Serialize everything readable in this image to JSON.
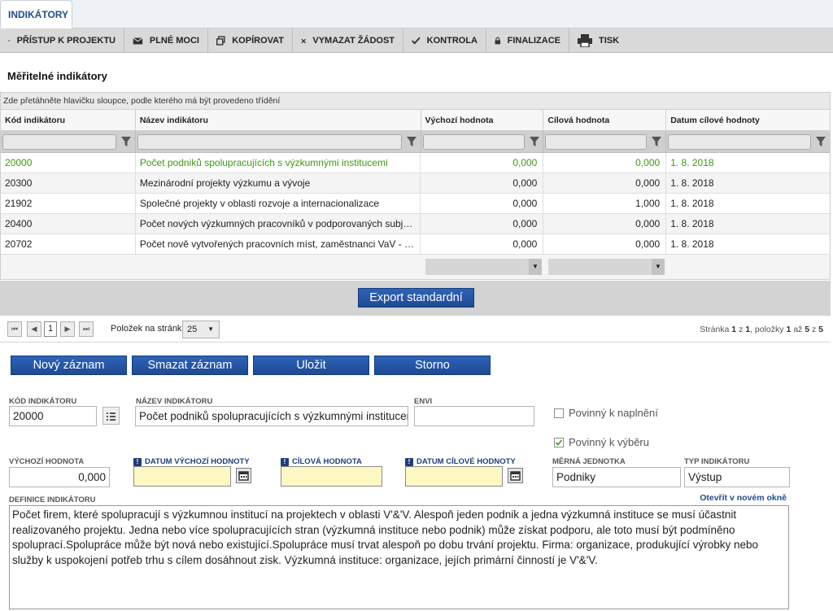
{
  "tab": {
    "label": "INDIKÁTORY"
  },
  "toolbar": {
    "items": [
      {
        "label": "PŘÍSTUP K PROJEKTU",
        "icon": "people-icon"
      },
      {
        "label": "PLNÉ MOCI",
        "icon": "envelope-icon"
      },
      {
        "label": "KOPÍROVAT",
        "icon": "copy-icon"
      },
      {
        "label": "VYMAZAT ŽÁDOST",
        "icon": "cross-icon"
      },
      {
        "label": "KONTROLA",
        "icon": "check-icon"
      },
      {
        "label": "FINALIZACE",
        "icon": "lock-icon"
      },
      {
        "label": "TISK",
        "icon": "printer-icon"
      }
    ]
  },
  "section": {
    "title": "Měřitelné indikátory"
  },
  "grid": {
    "group_hint": "Zde přetáhněte hlavičku sloupce, podle kterého má být provedeno třídění",
    "columns": [
      "Kód indikátoru",
      "Název indikátoru",
      "Výchozí hodnota",
      "Cílová hodnota",
      "Datum cílové hodnoty"
    ],
    "rows": [
      [
        "20000",
        "Počet podniků spolupracujících s výzkumnými institucemi",
        "0,000",
        "0,000",
        "1. 8. 2018"
      ],
      [
        "20300",
        "Mezinárodní projekty výzkumu a vývoje",
        "0,000",
        "0,000",
        "1. 8. 2018"
      ],
      [
        "21902",
        "Společné projekty v oblasti rozvoje a internacionalizace",
        "0,000",
        "1,000",
        "1. 8. 2018"
      ],
      [
        "20400",
        "Počet nových výzkumných pracovníků v podporovaných subjek...",
        "0,000",
        "0,000",
        "1. 8. 2018"
      ],
      [
        "20702",
        "Počet nově vytvořených pracovních míst, zaměstnanci VaV - že...",
        "0,000",
        "0,000",
        "1. 8. 2018"
      ]
    ],
    "selected_row": 0
  },
  "export": {
    "label": "Export standardní"
  },
  "pager": {
    "first": "⏮",
    "prev": "◀",
    "current_page": "1",
    "next": "▶",
    "last": "⏭",
    "page_size_label": "Položek na stránku",
    "page_size": "25",
    "status_prefix": "Stránka",
    "status_page": "1",
    "status_of": "z",
    "status_total_pages": "1",
    "status_items": ", položky",
    "status_from": "1",
    "status_to_word": "až",
    "status_to": "5",
    "status_of2": "z",
    "status_total_items": "5"
  },
  "actions": {
    "new": "Nový záznam",
    "delete": "Smazat záznam",
    "save": "Uložit",
    "cancel": "Storno"
  },
  "form": {
    "kod_label": "KÓD INDIKÁTORU",
    "kod_value": "20000",
    "nazev_label": "NÁZEV INDIKÁTORU",
    "nazev_value": "Počet podniků spolupracujících s výzkumnými institucemi",
    "envi_label": "ENVI",
    "envi_value": "",
    "povinny_naplneni_label": "Povinný k naplnění",
    "povinny_naplneni_checked": false,
    "povinny_vyberu_label": "Povinný k výběru",
    "povinny_vyberu_checked": true,
    "vychozi_label": "VÝCHOZÍ HODNOTA",
    "vychozi_value": "0,000",
    "datum_vychozi_label": "DATUM VÝCHOZÍ HODNOTY",
    "datum_vychozi_value": "",
    "cilova_label": "CÍLOVÁ HODNOTA",
    "cilova_value": "",
    "datum_cilove_label": "DATUM CÍLOVÉ HODNOTY",
    "datum_cilove_value": "",
    "merna_label": "MĚRNÁ JEDNOTKA",
    "merna_value": "Podniky",
    "typ_label": "TYP INDIKÁTORU",
    "typ_value": "Výstup",
    "definice_label": "DEFINICE INDIKÁTORU",
    "open_new_window": "Otevřít v novém okně",
    "definice_value": "Počet firem, které spolupracují s výzkumnou institucí na projektech v oblasti V'&'V. Alespoň jeden podnik a jedna výzkumná instituce se musí účastnit realizovaného projektu. Jedna nebo více spolupracujících stran (výzkumná instituce nebo podnik) může získat podporu, ale toto musí být podmíněno spoluprací.Spolupráce může být nová nebo existující.Spolupráce musí trvat alespoň po dobu trvání projektu. Firma: organizace, produkující výrobky nebo služby k uspokojení potřeb trhu s cílem dosáhnout zisk. Výzkumná instituce: organizace, jejích primární činností je V'&'V."
  },
  "colors": {
    "accent": "#1f4e8c",
    "button": "#2d63b8",
    "selected_text": "#3b9a12",
    "required_bg": "#fdf7c3"
  }
}
